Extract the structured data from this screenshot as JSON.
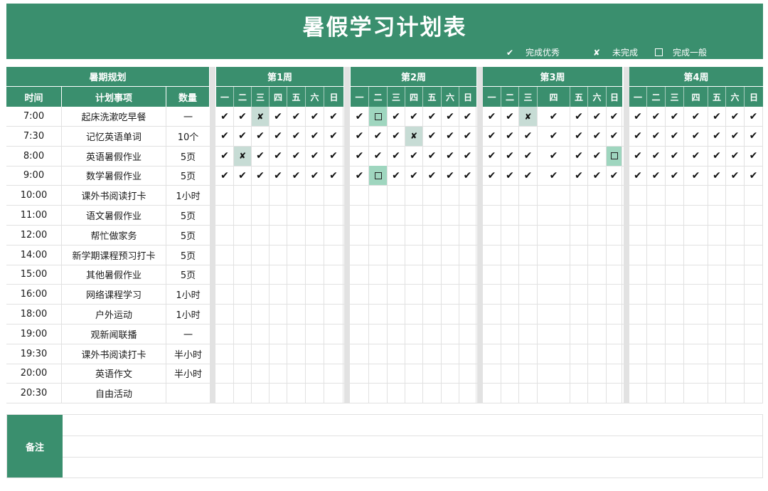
{
  "title": "暑假学习计划表",
  "legend": [
    {
      "symbol": "✔",
      "label": "完成优秀"
    },
    {
      "symbol": "✘",
      "label": "未完成"
    },
    {
      "symbol": "□",
      "label": "完成一般"
    }
  ],
  "left_header": {
    "section": "暑期规划",
    "col_time": "时间",
    "col_item": "计划事项",
    "col_qty": "数量"
  },
  "weeks": [
    "第1周",
    "第2周",
    "第3周",
    "第4周"
  ],
  "days": [
    "一",
    "二",
    "三",
    "四",
    "五",
    "六",
    "日"
  ],
  "rows": [
    {
      "time": "7:00",
      "item": "起床洗漱吃早餐",
      "qty": "一"
    },
    {
      "time": "7:30",
      "item": "记忆英语单词",
      "qty": "10个"
    },
    {
      "time": "8:00",
      "item": "英语暑假作业",
      "qty": "5页"
    },
    {
      "time": "9:00",
      "item": "数学暑假作业",
      "qty": "5页"
    },
    {
      "time": "10:00",
      "item": "课外书阅读打卡",
      "qty": "1小时"
    },
    {
      "time": "11:00",
      "item": "语文暑假作业",
      "qty": "5页"
    },
    {
      "time": "12:00",
      "item": "帮忙做家务",
      "qty": "5页"
    },
    {
      "time": "14:00",
      "item": "新学期课程预习打卡",
      "qty": "5页"
    },
    {
      "time": "15:00",
      "item": "其他暑假作业",
      "qty": "5页"
    },
    {
      "time": "16:00",
      "item": "网络课程学习",
      "qty": "1小时"
    },
    {
      "time": "18:00",
      "item": "户外运动",
      "qty": "1小时"
    },
    {
      "time": "19:00",
      "item": "观新闻联播",
      "qty": "一"
    },
    {
      "time": "19:30",
      "item": "课外书阅读打卡",
      "qty": "半小时"
    },
    {
      "time": "20:00",
      "item": "英语作文",
      "qty": "半小时"
    },
    {
      "time": "20:30",
      "item": "自由活动",
      "qty": ""
    }
  ],
  "marks": [
    [
      "ccxcccc",
      "csccccc",
      "ccxcccc",
      "ccccccc"
    ],
    [
      "ccccccc",
      "cccxccc",
      "ccccccc",
      "ccccccc"
    ],
    [
      "cxccccc",
      "ccccccc",
      "ccccccs",
      "ccccccc"
    ],
    [
      "ccccccc",
      "csccccc",
      "ccccccc",
      "ccccccc"
    ]
  ],
  "notes_label": "备注"
}
